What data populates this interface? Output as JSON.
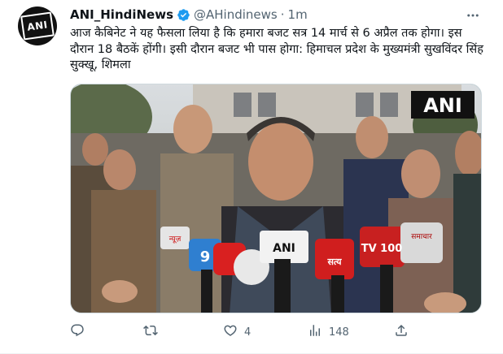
{
  "author": {
    "display_name": "ANI_HindiNews",
    "handle": "@AHindinews",
    "separator": "·",
    "time": "1m",
    "avatar_text": "ANI"
  },
  "tweet": {
    "text": "आज कैबिनेट ने यह फैसला लिया है कि हमारा बजट सत्र 14 मार्च से 6 अप्रैल तक होगा। इस दौरान 18 बैठकें होंगी। इसी दौरान बजट भी पास होगा: हिमाचल प्रदेश के मुख्यमंत्री सुखविंदर सिंह सुक्खू, शिमला"
  },
  "media": {
    "watermark": "ANI",
    "mic_labels": [
      "ANI",
      "TV 100",
      "सत्य",
      "9",
      "न्यूज़",
      "समाचार"
    ]
  },
  "actions": {
    "reply_count": "",
    "retweet_count": "",
    "like_count": "4",
    "views_count": "148"
  },
  "colors": {
    "text": "#0f1419",
    "secondary": "#536471",
    "verified": "#1d9bf0"
  }
}
